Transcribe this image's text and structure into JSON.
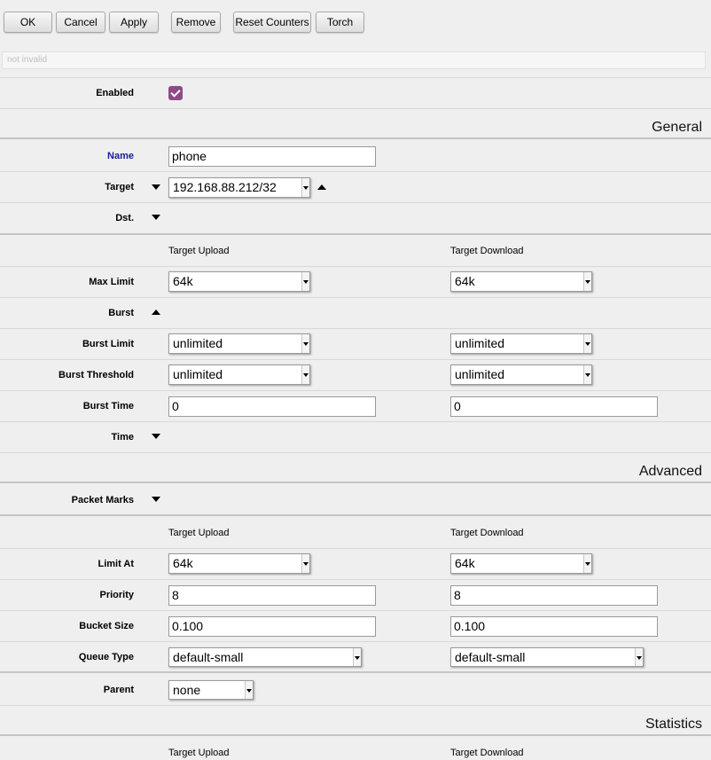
{
  "toolbar": {
    "ok": "OK",
    "cancel": "Cancel",
    "apply": "Apply",
    "remove": "Remove",
    "reset_counters": "Reset Counters",
    "torch": "Torch"
  },
  "status": "not invalid",
  "enabled": {
    "label": "Enabled",
    "checked": true,
    "color": "#8e4a87"
  },
  "general": {
    "title": "General",
    "name_label": "Name",
    "name_value": "phone",
    "target_label": "Target",
    "target_value": "192.168.88.212/32",
    "dst_label": "Dst."
  },
  "limits": {
    "col_upload": "Target Upload",
    "col_download": "Target Download",
    "max_limit_label": "Max Limit",
    "max_limit_upload": "64k",
    "max_limit_download": "64k",
    "burst_label": "Burst",
    "burst_limit_label": "Burst Limit",
    "burst_limit_upload": "unlimited",
    "burst_limit_download": "unlimited",
    "burst_threshold_label": "Burst Threshold",
    "burst_threshold_upload": "unlimited",
    "burst_threshold_download": "unlimited",
    "burst_time_label": "Burst Time",
    "burst_time_upload": "0",
    "burst_time_download": "0",
    "time_label": "Time"
  },
  "advanced": {
    "title": "Advanced",
    "packet_marks_label": "Packet Marks",
    "col_upload": "Target Upload",
    "col_download": "Target Download",
    "limit_at_label": "Limit At",
    "limit_at_upload": "64k",
    "limit_at_download": "64k",
    "priority_label": "Priority",
    "priority_upload": "8",
    "priority_download": "8",
    "bucket_size_label": "Bucket Size",
    "bucket_size_upload": "0.100",
    "bucket_size_download": "0.100",
    "queue_type_label": "Queue Type",
    "queue_type_upload": "default-small",
    "queue_type_download": "default-small",
    "parent_label": "Parent",
    "parent_value": "none"
  },
  "statistics": {
    "title": "Statistics",
    "col_upload": "Target Upload",
    "col_download": "Target Download"
  }
}
